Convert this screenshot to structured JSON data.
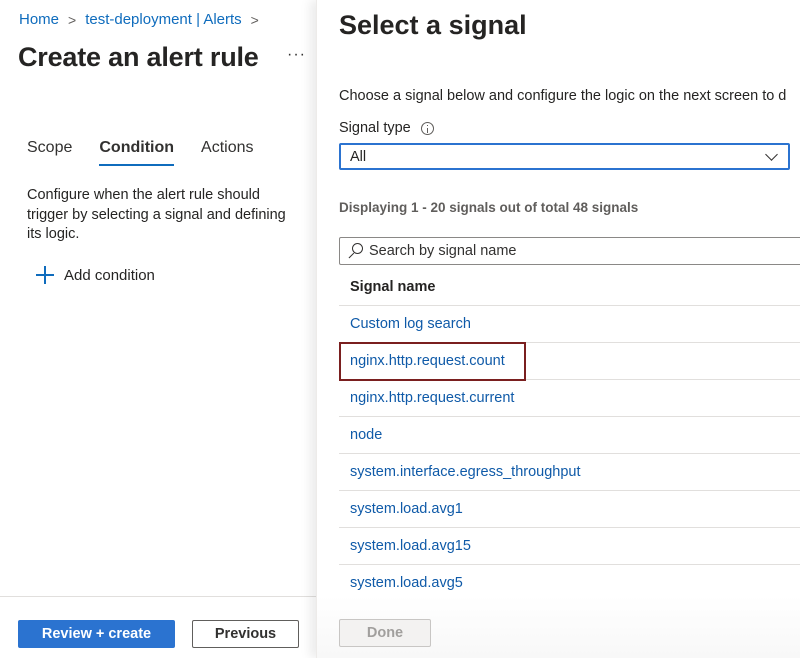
{
  "breadcrumb": {
    "items": [
      "Home",
      "test-deployment | Alerts"
    ],
    "separator": ">"
  },
  "page": {
    "title": "Create an alert rule",
    "more_label": "···"
  },
  "tabs": [
    {
      "label": "Scope",
      "active": false
    },
    {
      "label": "Condition",
      "active": true
    },
    {
      "label": "Actions",
      "active": false
    }
  ],
  "condition": {
    "description": "Configure when the alert rule should trigger by selecting a signal and defining its logic.",
    "add_condition_label": "Add condition",
    "add_condition_icon": "plus-icon"
  },
  "left_footer": {
    "review_create_label": "Review + create",
    "previous_label": "Previous"
  },
  "blade": {
    "title": "Select a signal",
    "intro": "Choose a signal below and configure the logic on the next screen to d",
    "signal_type_label": "Signal type",
    "signal_type_info_icon": "info-icon",
    "signal_type_value": "All",
    "count_text": "Displaying 1 - 20 signals out of total 48 signals",
    "search_placeholder": "Search by signal name",
    "table_header": "Signal name",
    "signals": [
      "Custom log search",
      "nginx.http.request.count",
      "nginx.http.request.current",
      "node",
      "system.interface.egress_throughput",
      "system.load.avg1",
      "system.load.avg15",
      "system.load.avg5"
    ],
    "highlighted_signal": "nginx.http.request.count",
    "done_label": "Done"
  },
  "colors": {
    "accent": "#0f6cbd",
    "primary_button": "#2b73d0",
    "link": "#0f5aa8",
    "highlight_border": "#7a1f1f",
    "disabled_text": "#a19f9d"
  }
}
